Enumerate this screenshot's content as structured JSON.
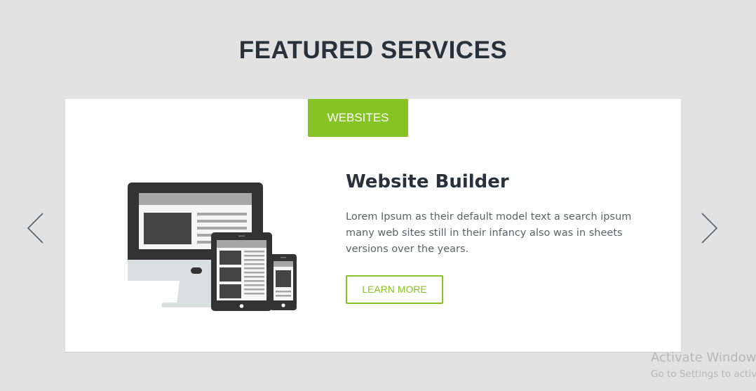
{
  "section": {
    "title": "FEATURED SERVICES"
  },
  "slider": {
    "active_tab": "WEBSITES",
    "service_title": "Website Builder",
    "service_description": "Lorem Ipsum as their default model text a search ipsum many web sites still in their infancy also was in sheets versions over the years.",
    "cta_label": "LEARN MORE",
    "prev_icon": "chevron-left-icon",
    "next_icon": "chevron-right-icon",
    "illustration_icon": "responsive-devices-icon"
  },
  "watermark": {
    "title": "Activate Windows",
    "subtitle": "Go to Settings to activate Windows."
  },
  "colors": {
    "background": "#e2e2e2",
    "card": "#ffffff",
    "accent": "#86c424",
    "heading": "#28323c",
    "body_text": "#5e6266",
    "arrow": "#5a5f64",
    "watermark": "#b7b7b7"
  }
}
